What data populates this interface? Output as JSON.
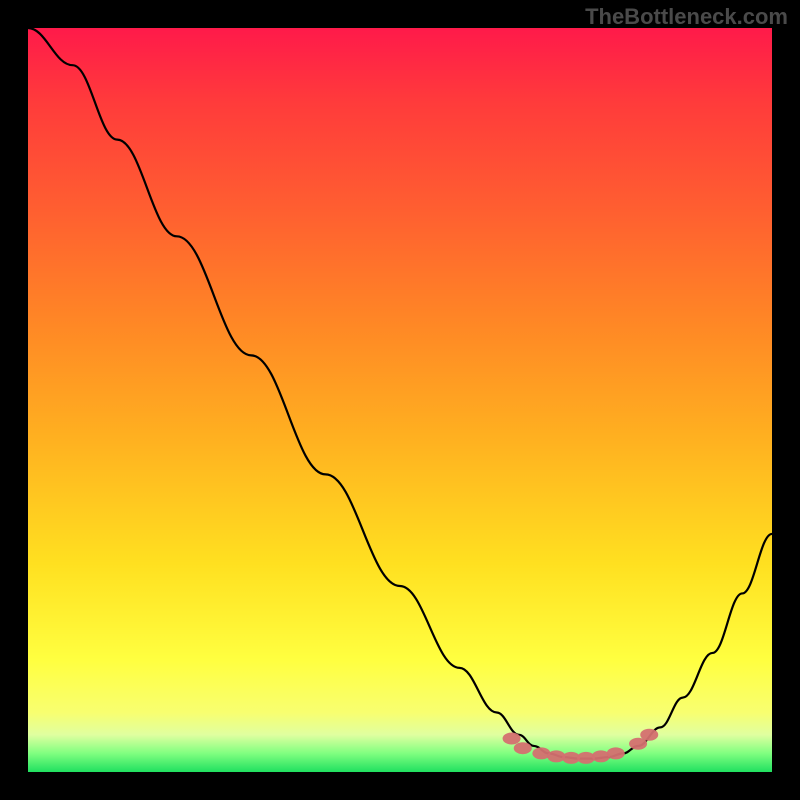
{
  "watermark": "TheBottleneck.com",
  "chart_data": {
    "type": "line",
    "title": "",
    "xlabel": "",
    "ylabel": "",
    "xlim": [
      0,
      100
    ],
    "ylim": [
      0,
      100
    ],
    "background_gradient": "rainbow_red_to_green",
    "series": [
      {
        "name": "bottleneck-curve",
        "color": "#000000",
        "x": [
          0,
          6,
          12,
          20,
          30,
          40,
          50,
          58,
          63,
          66,
          68,
          70,
          72,
          74,
          76,
          78,
          80,
          82,
          85,
          88,
          92,
          96,
          100
        ],
        "y": [
          100,
          95,
          85,
          72,
          56,
          40,
          25,
          14,
          8,
          5,
          3.5,
          2.5,
          2,
          1.8,
          1.8,
          2,
          2.5,
          3.5,
          6,
          10,
          16,
          24,
          32
        ]
      }
    ],
    "markers": {
      "name": "optimal-range-markers",
      "color": "#d47070",
      "shape": "pill",
      "points": [
        {
          "x": 65,
          "y": 4.5
        },
        {
          "x": 66.5,
          "y": 3.2
        },
        {
          "x": 69,
          "y": 2.5
        },
        {
          "x": 71,
          "y": 2.1
        },
        {
          "x": 73,
          "y": 1.9
        },
        {
          "x": 75,
          "y": 1.9
        },
        {
          "x": 77,
          "y": 2.1
        },
        {
          "x": 79,
          "y": 2.5
        },
        {
          "x": 82,
          "y": 3.8
        },
        {
          "x": 83.5,
          "y": 5
        }
      ]
    }
  }
}
